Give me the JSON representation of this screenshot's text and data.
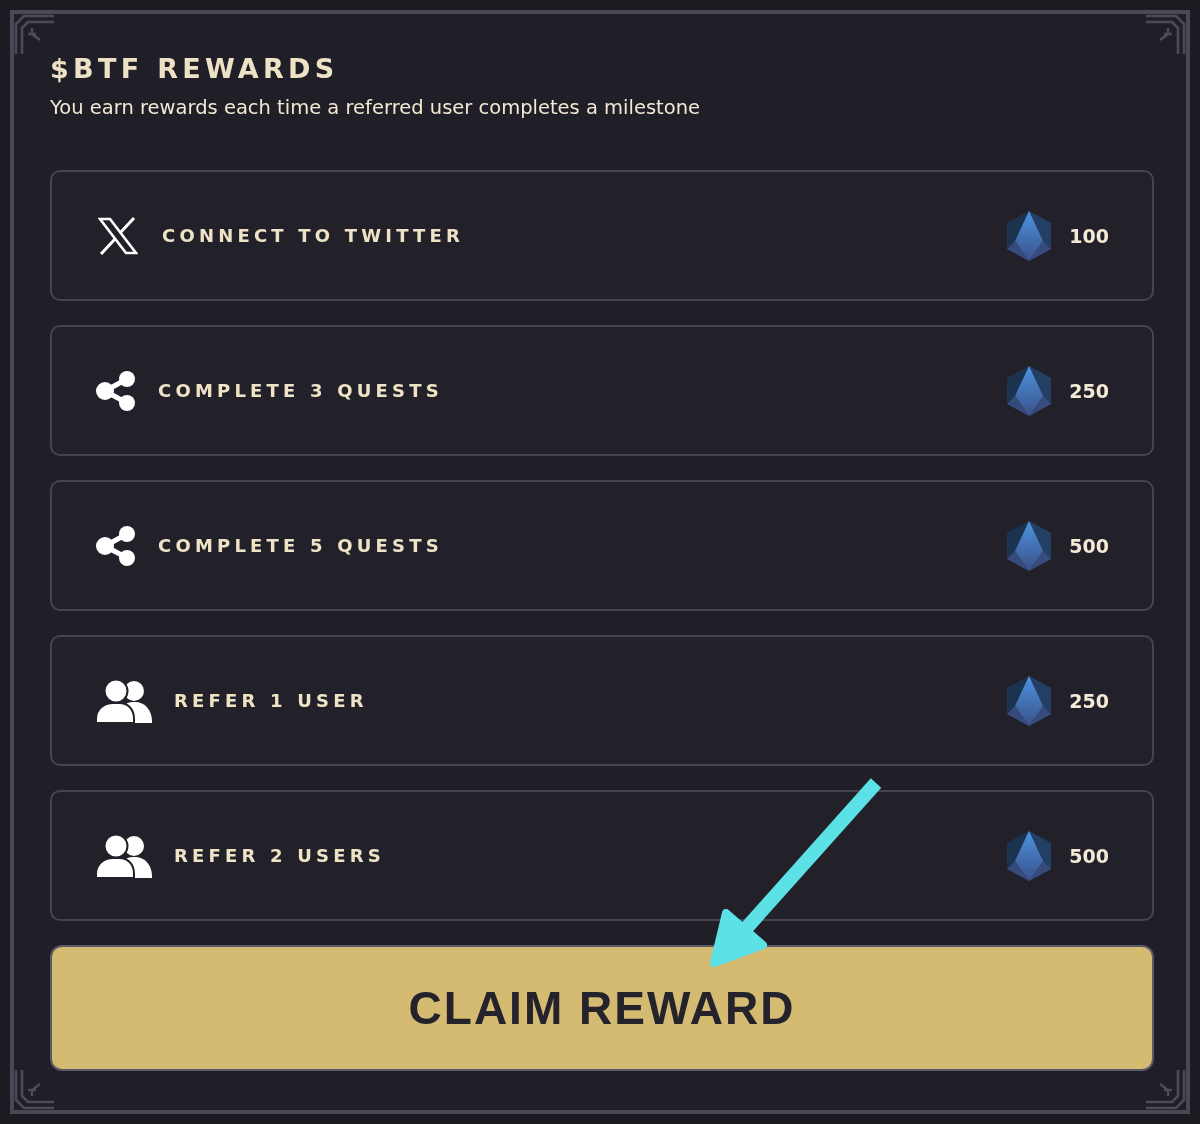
{
  "panel": {
    "title": "$BTF REWARDS",
    "subtitle": "You earn rewards each time a referred user completes a milestone"
  },
  "rewards": [
    {
      "kind": "social",
      "label": "CONNECT TO TWITTER",
      "amount": "100"
    },
    {
      "kind": "quest",
      "label": "COMPLETE 3 QUESTS",
      "amount": "250"
    },
    {
      "kind": "quest",
      "label": "COMPLETE 5 QUESTS",
      "amount": "500"
    },
    {
      "kind": "referral",
      "label": "REFER 1 USER",
      "amount": "250"
    },
    {
      "kind": "referral",
      "label": "REFER 2 USERS",
      "amount": "500"
    }
  ],
  "claim_button": {
    "label": "CLAIM REWARD"
  }
}
